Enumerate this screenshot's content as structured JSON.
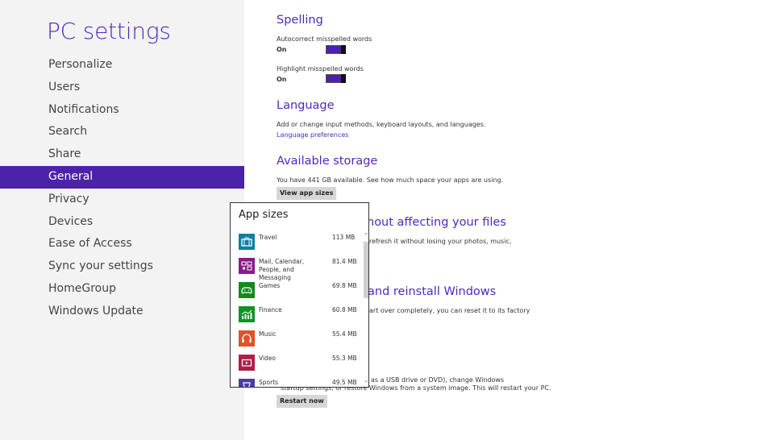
{
  "sidebar": {
    "title": "PC settings",
    "items": [
      {
        "label": "Personalize"
      },
      {
        "label": "Users"
      },
      {
        "label": "Notifications"
      },
      {
        "label": "Search"
      },
      {
        "label": "Share"
      },
      {
        "label": "General",
        "active": true
      },
      {
        "label": "Privacy"
      },
      {
        "label": "Devices"
      },
      {
        "label": "Ease of Access"
      },
      {
        "label": "Sync your settings"
      },
      {
        "label": "HomeGroup"
      },
      {
        "label": "Windows Update"
      }
    ]
  },
  "spelling": {
    "title": "Spelling",
    "autocorrect_label": "Autocorrect misspelled words",
    "autocorrect_state": "On",
    "highlight_label": "Highlight misspelled words",
    "highlight_state": "On"
  },
  "language": {
    "title": "Language",
    "desc": "Add or change input methods, keyboard layouts, and languages.",
    "link": "Language preferences"
  },
  "storage": {
    "title": "Available storage",
    "desc": "You have 441 GB available. See how much space your apps are using.",
    "button": "View app sizes"
  },
  "refresh": {
    "title_partial": "hout affecting your files",
    "desc_partial": "refresh it without losing your photos, music,"
  },
  "reset": {
    "title_partial": "and reinstall Windows",
    "desc_partial": "art over completely, you can reset it to its factory"
  },
  "advanced": {
    "desc_line1_partial": "as a USB drive or DVD), change Windows",
    "desc_line2_partial": "startup settings, or restore Windows from a system image. This will restart your PC.",
    "button": "Restart now"
  },
  "flyout": {
    "title": "App sizes",
    "apps": [
      {
        "name": "Travel",
        "size": "113 MB",
        "color": "#0f7ea2",
        "icon": "suitcase-icon"
      },
      {
        "name": "Mail, Calendar, People, and Messaging",
        "size": "81.4 MB",
        "color": "#8a1a8c",
        "icon": "mail-calendar-icon"
      },
      {
        "name": "Games",
        "size": "69.8 MB",
        "color": "#118a1b",
        "icon": "gamepad-icon"
      },
      {
        "name": "Finance",
        "size": "60.8 MB",
        "color": "#109426",
        "icon": "chart-icon"
      },
      {
        "name": "Music",
        "size": "55.4 MB",
        "color": "#e05327",
        "icon": "headphones-icon"
      },
      {
        "name": "Video",
        "size": "55.3 MB",
        "color": "#b01e47",
        "icon": "video-icon"
      },
      {
        "name": "Sports",
        "size": "49.5 MB",
        "color": "#4a3baa",
        "icon": "trophy-icon"
      }
    ]
  },
  "colors": {
    "accent": "#4b22a9",
    "sidebar_bg": "#f3f3f3"
  }
}
